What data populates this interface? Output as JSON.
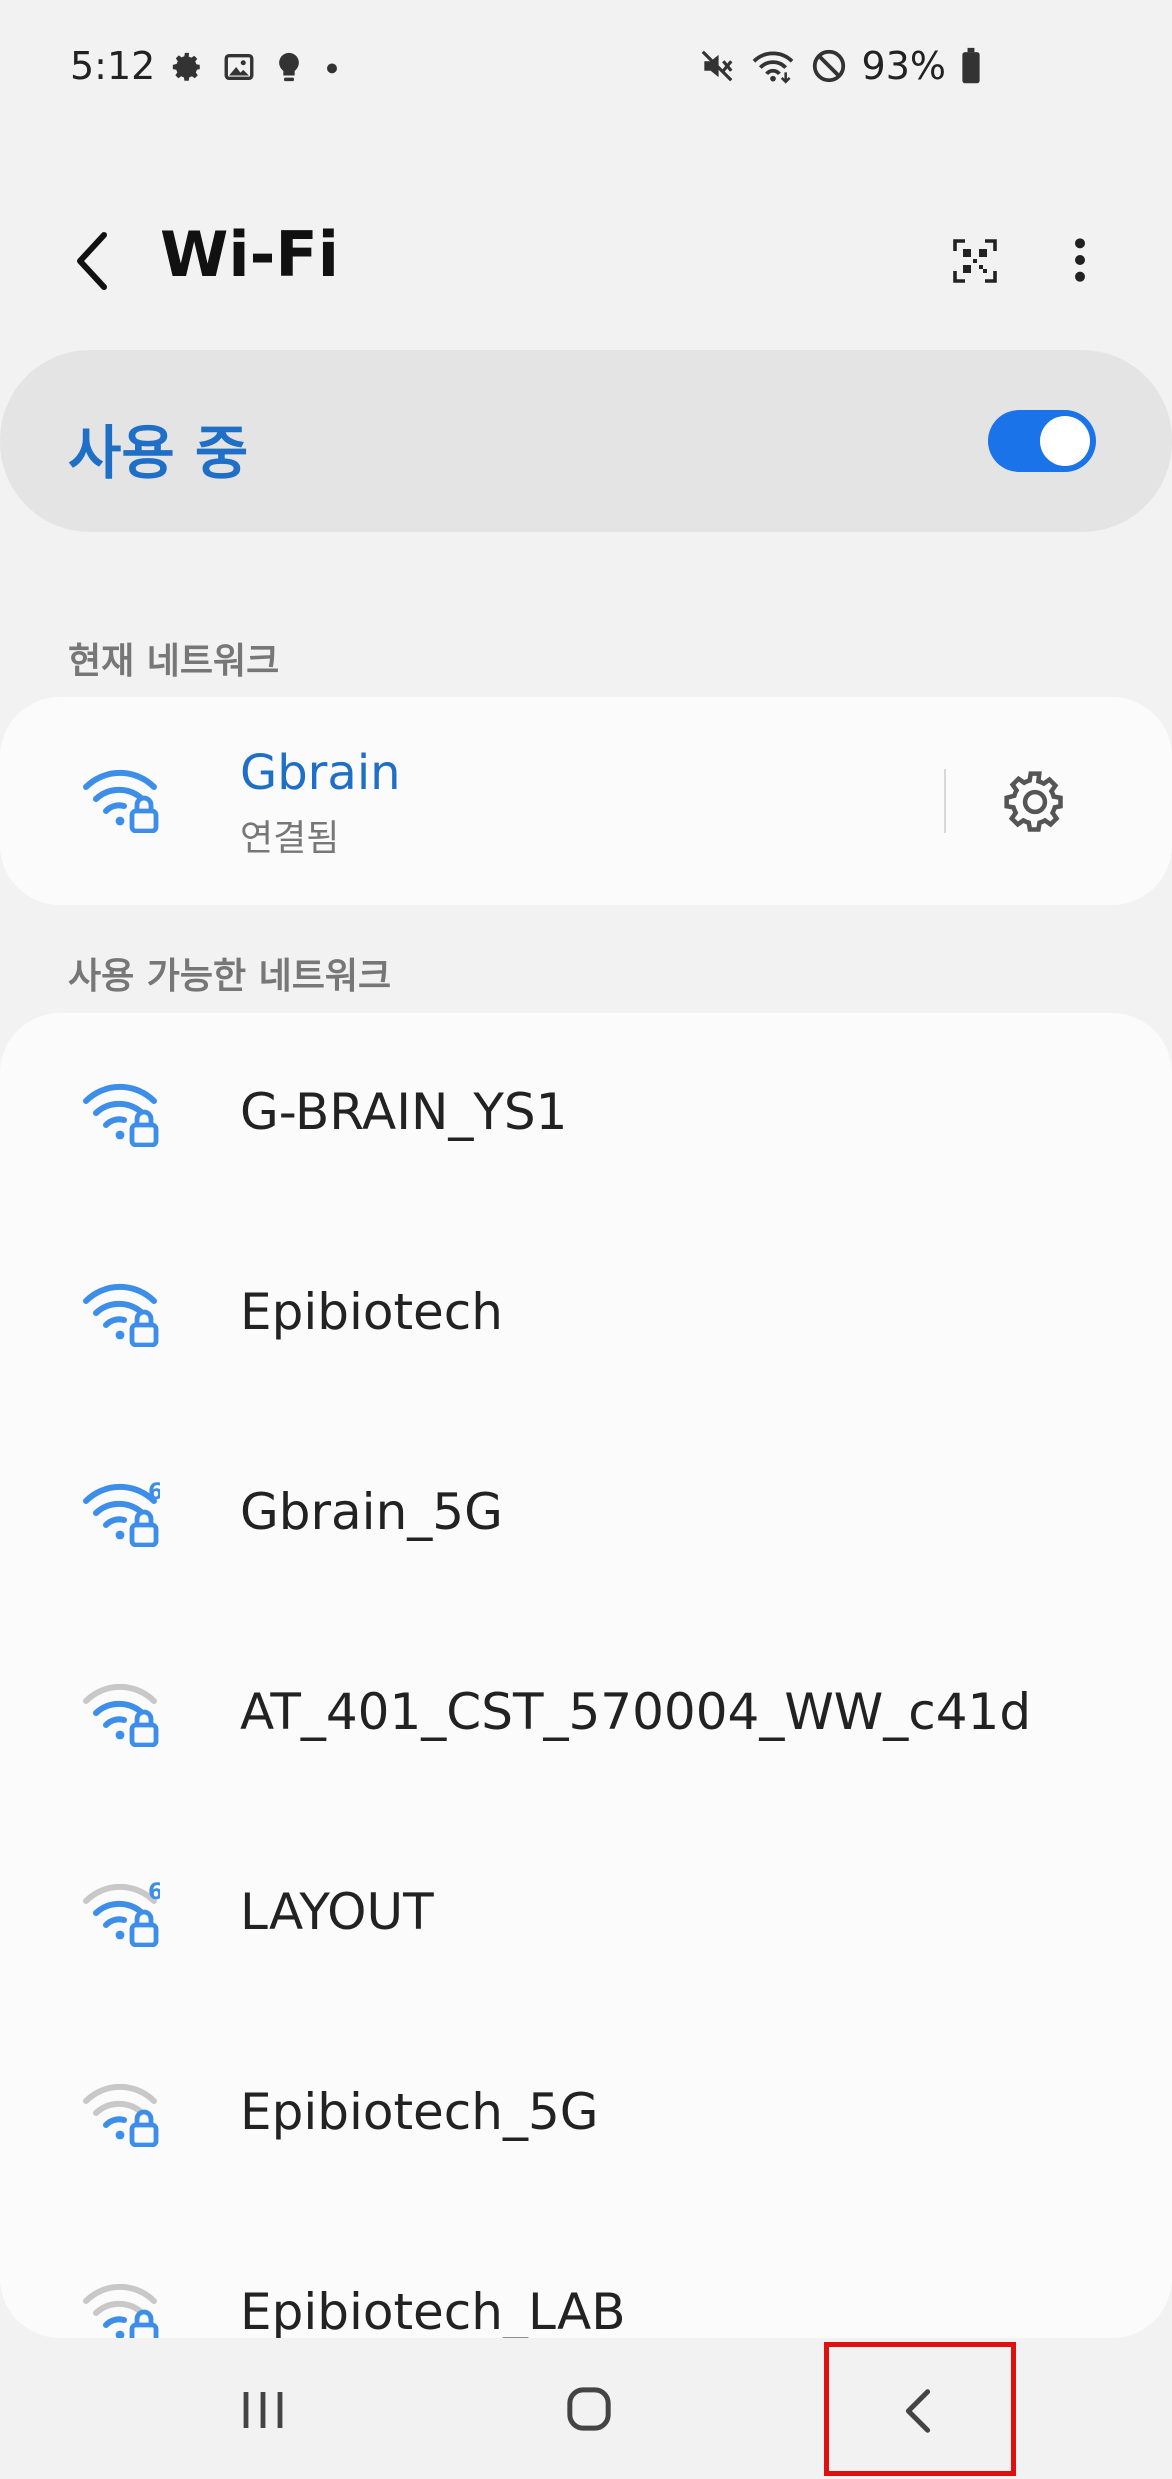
{
  "status_bar": {
    "time": "5:12",
    "battery": "93%",
    "left_icons": [
      "gear-icon",
      "image-icon",
      "bulb-icon",
      "dot-icon"
    ],
    "right_icons": [
      "mute-icon",
      "wifi-icon",
      "block-icon",
      "battery-icon"
    ]
  },
  "header": {
    "title": "Wi-Fi"
  },
  "master_switch": {
    "label": "사용 중",
    "on": true,
    "accent": "#1a73e8"
  },
  "current_network": {
    "section_label": "현재 네트워크",
    "name": "Gbrain",
    "status": "연결됨"
  },
  "available_networks": {
    "section_label": "사용 가능한 네트워크",
    "items": [
      {
        "name": "G-BRAIN_YS1",
        "strength": "full",
        "wifi6": false
      },
      {
        "name": "Epibiotech",
        "strength": "full",
        "wifi6": false
      },
      {
        "name": "Gbrain_5G",
        "strength": "full",
        "wifi6": true
      },
      {
        "name": "AT_401_CST_570004_WW_c41d",
        "strength": "medium",
        "wifi6": false
      },
      {
        "name": "LAYOUT",
        "strength": "medium",
        "wifi6": true
      },
      {
        "name": "Epibiotech_5G",
        "strength": "low",
        "wifi6": false
      },
      {
        "name": "Epibiotech_LAB",
        "strength": "low",
        "wifi6": false
      }
    ]
  },
  "colors": {
    "wifi_blue": "#3d8ee8",
    "wifi_gray": "#c8c8c8",
    "highlight": "#e01010"
  }
}
